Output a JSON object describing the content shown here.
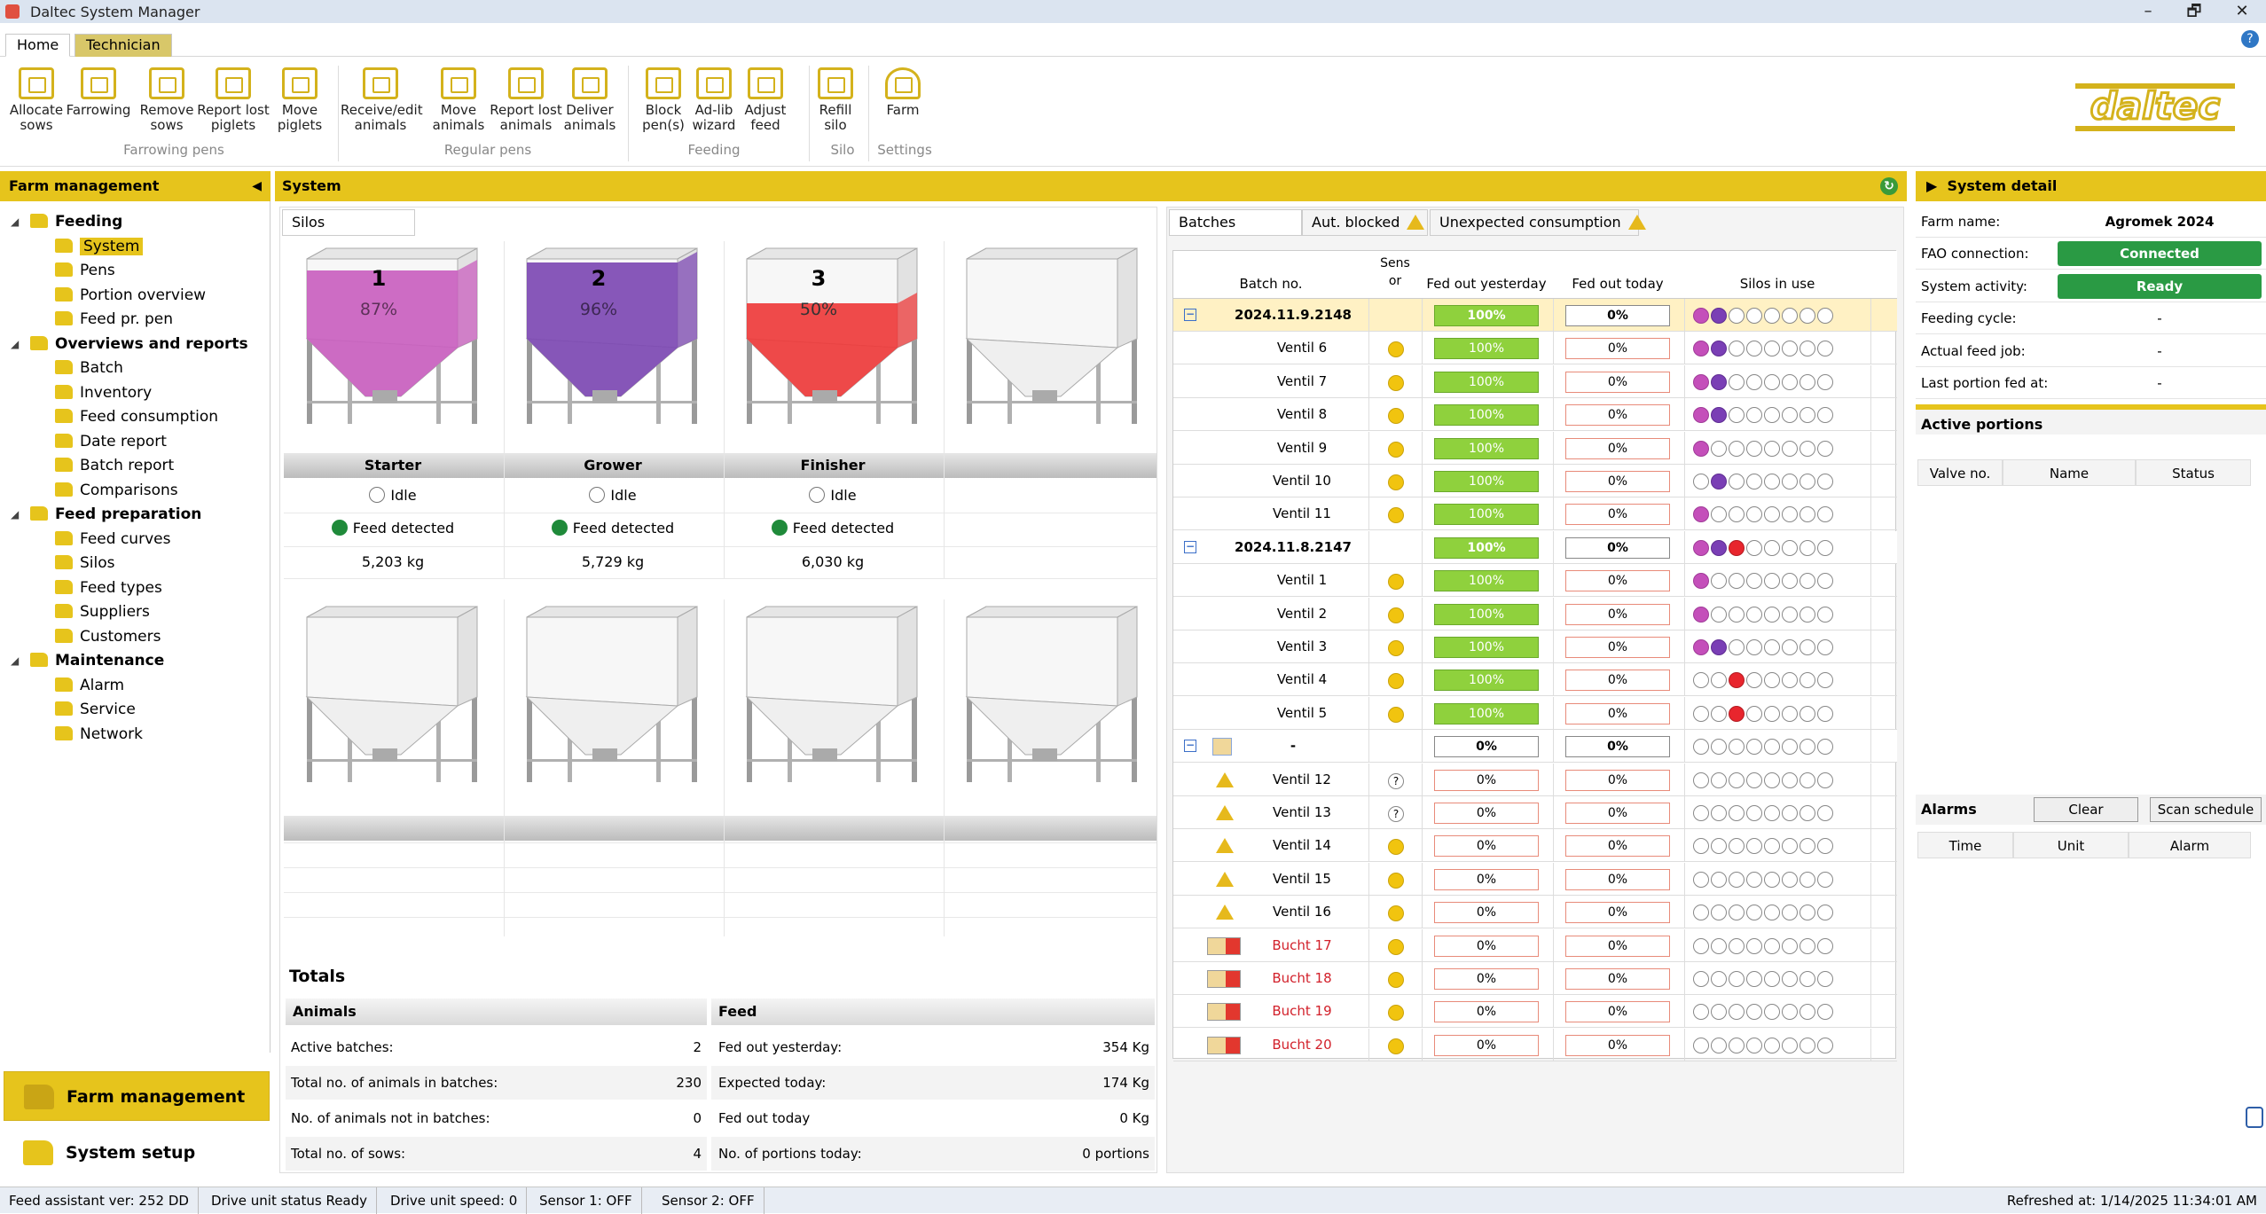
{
  "window": {
    "title": "Daltec System Manager",
    "minimize": "–",
    "restore": "🗗",
    "close": "✕"
  },
  "ribbon_tabs": [
    "Home",
    "Technician"
  ],
  "ribbon": {
    "buttons": [
      {
        "l1": "Allocate",
        "l2": "sows"
      },
      {
        "l1": "Farrowing",
        "l2": ""
      },
      {
        "l1": "Remove",
        "l2": "sows"
      },
      {
        "l1": "Report lost",
        "l2": "piglets"
      },
      {
        "l1": "Move",
        "l2": "piglets"
      },
      {
        "l1": "Receive/edit",
        "l2": "animals"
      },
      {
        "l1": "Move",
        "l2": "animals"
      },
      {
        "l1": "Report lost",
        "l2": "animals"
      },
      {
        "l1": "Deliver",
        "l2": "animals"
      },
      {
        "l1": "Block",
        "l2": "pen(s)"
      },
      {
        "l1": "Ad-lib",
        "l2": "wizard"
      },
      {
        "l1": "Adjust",
        "l2": "feed"
      },
      {
        "l1": "Refill",
        "l2": "silo"
      },
      {
        "l1": "Farm",
        "l2": ""
      }
    ],
    "groups": [
      "Farrowing pens",
      "Regular pens",
      "Feeding",
      "Silo",
      "Settings"
    ]
  },
  "logo_text": "daltec",
  "farm_management": {
    "title": "Farm management",
    "tree": [
      {
        "label": "Feeding",
        "level": 0
      },
      {
        "label": "System",
        "level": 1
      },
      {
        "label": "Pens",
        "level": 1
      },
      {
        "label": "Portion overview",
        "level": 1
      },
      {
        "label": "Feed pr. pen",
        "level": 1
      },
      {
        "label": "Overviews and reports",
        "level": 0
      },
      {
        "label": "Batch",
        "level": 1
      },
      {
        "label": "Inventory",
        "level": 1
      },
      {
        "label": "Feed consumption",
        "level": 1
      },
      {
        "label": "Date report",
        "level": 1
      },
      {
        "label": "Batch report",
        "level": 1
      },
      {
        "label": "Comparisons",
        "level": 1
      },
      {
        "label": "Feed preparation",
        "level": 0
      },
      {
        "label": "Feed curves",
        "level": 1
      },
      {
        "label": "Silos",
        "level": 1
      },
      {
        "label": "Feed types",
        "level": 1
      },
      {
        "label": "Suppliers",
        "level": 1
      },
      {
        "label": "Customers",
        "level": 1
      },
      {
        "label": "Maintenance",
        "level": 0
      },
      {
        "label": "Alarm",
        "level": 1
      },
      {
        "label": "Service",
        "level": 1
      },
      {
        "label": "Network",
        "level": 1
      }
    ],
    "nav_farm": "Farm management",
    "nav_setup": "System setup"
  },
  "system": {
    "title": "System",
    "silos_tab": "Silos",
    "silos": [
      {
        "num": "1",
        "pct": "87%",
        "fill": 0.87,
        "color": "#c95fbf",
        "name": "Starter",
        "state": "Idle",
        "detect": "Feed detected",
        "weight": "5,203 kg"
      },
      {
        "num": "2",
        "pct": "96%",
        "fill": 0.96,
        "color": "#7d49b3",
        "name": "Grower",
        "state": "Idle",
        "detect": "Feed detected",
        "weight": "5,729 kg"
      },
      {
        "num": "3",
        "pct": "50%",
        "fill": 0.5,
        "color": "#ee3b3b",
        "name": "Finisher",
        "state": "Idle",
        "detect": "Feed detected",
        "weight": "6,030 kg"
      }
    ],
    "totals": {
      "title": "Totals",
      "animals_head": "Animals",
      "feed_head": "Feed",
      "animals": [
        {
          "k": "Active batches:",
          "v": "2"
        },
        {
          "k": "Total no. of animals in batches:",
          "v": "230"
        },
        {
          "k": "No. of animals not in batches:",
          "v": "0"
        },
        {
          "k": "Total no. of sows:",
          "v": "4"
        }
      ],
      "feed": [
        {
          "k": "Fed out yesterday:",
          "v": "354 Kg"
        },
        {
          "k": "Expected today:",
          "v": "174 Kg"
        },
        {
          "k": "Fed out today",
          "v": "0 Kg"
        },
        {
          "k": "No. of portions today:",
          "v": "0 portions"
        }
      ]
    }
  },
  "batches": {
    "tabs": [
      "Batches",
      "Aut. blocked",
      "Unexpected consumption"
    ],
    "headers": {
      "batch": "Batch no.",
      "sensor1": "Sens",
      "sensor2": "or",
      "yesterday": "Fed out yesterday",
      "today": "Fed out today",
      "silos": "Silos in use"
    },
    "rows": [
      {
        "kind": "batch",
        "label": "2024.11.9.2148",
        "y": "100%",
        "t": "0%",
        "dots": "pv      ",
        "sel": true
      },
      {
        "kind": "valve",
        "label": "Ventil 6",
        "y": "100%",
        "t": "0%",
        "dots": "pv      "
      },
      {
        "kind": "valve",
        "label": "Ventil 7",
        "y": "100%",
        "t": "0%",
        "dots": "pv      "
      },
      {
        "kind": "valve",
        "label": "Ventil 8",
        "y": "100%",
        "t": "0%",
        "dots": "pv      "
      },
      {
        "kind": "valve",
        "label": "Ventil 9",
        "y": "100%",
        "t": "0%",
        "dots": "p       "
      },
      {
        "kind": "valve",
        "label": "Ventil 10",
        "y": "100%",
        "t": "0%",
        "dots": " v      "
      },
      {
        "kind": "valve",
        "label": "Ventil 11",
        "y": "100%",
        "t": "0%",
        "dots": "p       "
      },
      {
        "kind": "batch",
        "label": "2024.11.8.2147",
        "y": "100%",
        "t": "0%",
        "dots": "pvr     "
      },
      {
        "kind": "valve",
        "label": "Ventil 1",
        "y": "100%",
        "t": "0%",
        "dots": "p       "
      },
      {
        "kind": "valve",
        "label": "Ventil 2",
        "y": "100%",
        "t": "0%",
        "dots": "p       "
      },
      {
        "kind": "valve",
        "label": "Ventil 3",
        "y": "100%",
        "t": "0%",
        "dots": "pv      "
      },
      {
        "kind": "valve",
        "label": "Ventil 4",
        "y": "100%",
        "t": "0%",
        "dots": "  r     "
      },
      {
        "kind": "valve",
        "label": "Ventil 5",
        "y": "100%",
        "t": "0%",
        "dots": "  r     "
      },
      {
        "kind": "nobatch",
        "label": "-",
        "y": "0%",
        "t": "0%",
        "dots": "        "
      },
      {
        "kind": "warn",
        "label": "Ventil 12",
        "y": "0%",
        "t": "0%",
        "dots": "        ",
        "sensor": "?"
      },
      {
        "kind": "warn",
        "label": "Ventil 13",
        "y": "0%",
        "t": "0%",
        "dots": "        ",
        "sensor": "?"
      },
      {
        "kind": "warn",
        "label": "Ventil 14",
        "y": "0%",
        "t": "0%",
        "dots": "        "
      },
      {
        "kind": "warn",
        "label": "Ventil 15",
        "y": "0%",
        "t": "0%",
        "dots": "        "
      },
      {
        "kind": "warn",
        "label": "Ventil 16",
        "y": "0%",
        "t": "0%",
        "dots": "        "
      },
      {
        "kind": "flag",
        "label": "Bucht 17",
        "y": "0%",
        "t": "0%",
        "dots": "        "
      },
      {
        "kind": "flag",
        "label": "Bucht 18",
        "y": "0%",
        "t": "0%",
        "dots": "        "
      },
      {
        "kind": "flag",
        "label": "Bucht 19",
        "y": "0%",
        "t": "0%",
        "dots": "        "
      },
      {
        "kind": "flag",
        "label": "Bucht 20",
        "y": "0%",
        "t": "0%",
        "dots": "        "
      }
    ]
  },
  "detail": {
    "title": "System detail",
    "rows": [
      {
        "k": "Farm name:",
        "v": "Agromek 2024",
        "style": "bold"
      },
      {
        "k": "FAO connection:",
        "v": "Connected",
        "style": "btn"
      },
      {
        "k": "System activity:",
        "v": "Ready",
        "style": "btn"
      },
      {
        "k": "Feeding cycle:",
        "v": "-",
        "style": ""
      },
      {
        "k": "Actual feed job:",
        "v": "-",
        "style": ""
      },
      {
        "k": "Last portion fed at:",
        "v": "-",
        "style": ""
      }
    ],
    "portions_title": "Active portions",
    "portions_cols": [
      "Valve no.",
      "Name",
      "Status"
    ],
    "alarms_title": "Alarms",
    "clear": "Clear",
    "scan": "Scan schedule",
    "alarms_cols": [
      "Time",
      "Unit",
      "Alarm"
    ]
  },
  "status": {
    "items": [
      "Feed assistant ver: 252 DD",
      "Drive unit status Ready",
      "Drive unit speed: 0",
      "Sensor 1: OFF",
      "Sensor 2: OFF"
    ],
    "refreshed": "Refreshed at: 1/14/2025 11:34:01 AM"
  },
  "colors": {
    "accent": "#e6c41c",
    "ok": "#2a9a44"
  }
}
